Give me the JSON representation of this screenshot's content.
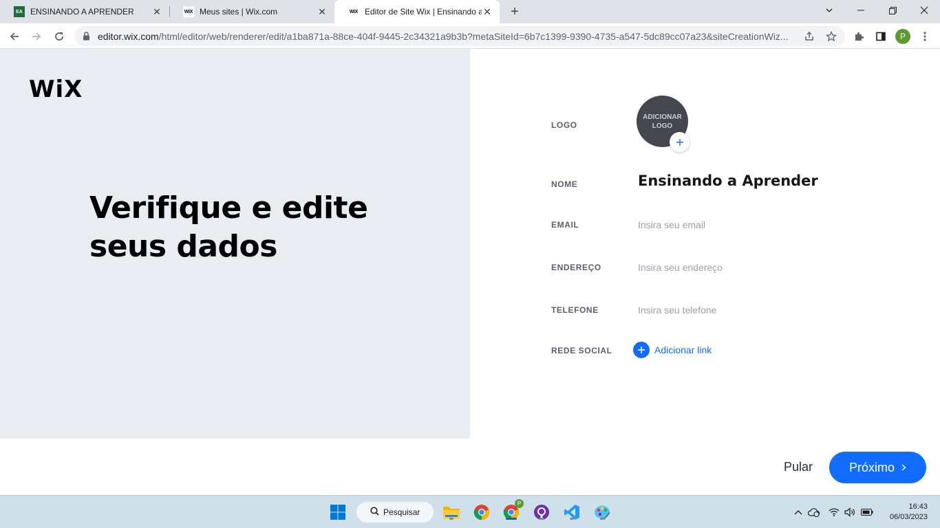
{
  "browser": {
    "tabs": [
      {
        "title": "ENSINANDO A APRENDER",
        "favicon": "ensinando-favicon",
        "active": false
      },
      {
        "title": "Meus sites | Wix.com",
        "favicon": "wix-favicon",
        "active": false
      },
      {
        "title": "Editor de Site Wix | Ensinando a Aprender",
        "favicon": "wix-favicon",
        "active": true
      }
    ],
    "favicon_text": {
      "wix": "WiX",
      "ensinando": "EA"
    },
    "url_host": "editor.wix.com",
    "url_path": "/html/editor/web/renderer/edit/a1ba871a-88ce-404f-9445-2c34321a9b3b?metaSiteId=6b7c1399-9390-4735-a547-5dc89cc07a23&siteCreationWiz...",
    "profile_initial": "P"
  },
  "page": {
    "brand": "WiX",
    "headline": "Verifique e edite seus dados",
    "fields": {
      "logo": {
        "label": "LOGO",
        "button_text": "ADICIONAR LOGO"
      },
      "name": {
        "label": "NOME",
        "value": "Ensinando a Aprender"
      },
      "email": {
        "label": "EMAIL",
        "placeholder": "Insira seu email"
      },
      "address": {
        "label": "ENDEREÇO",
        "placeholder": "Insira seu endereço"
      },
      "phone": {
        "label": "TELEFONE",
        "placeholder": "Insira seu telefone"
      },
      "social": {
        "label": "REDE SOCIAL",
        "link_text": "Adicionar link"
      }
    },
    "footer": {
      "skip_label": "Pular",
      "next_label": "Próximo"
    }
  },
  "taskbar": {
    "search_label": "Pesquisar",
    "time": "16:43",
    "date": "06/03/2023",
    "chrome_profile_badge": "P"
  },
  "colors": {
    "accent": "#116dff",
    "left_panel": "#e9ecf1",
    "logo_circle": "#44474e"
  }
}
